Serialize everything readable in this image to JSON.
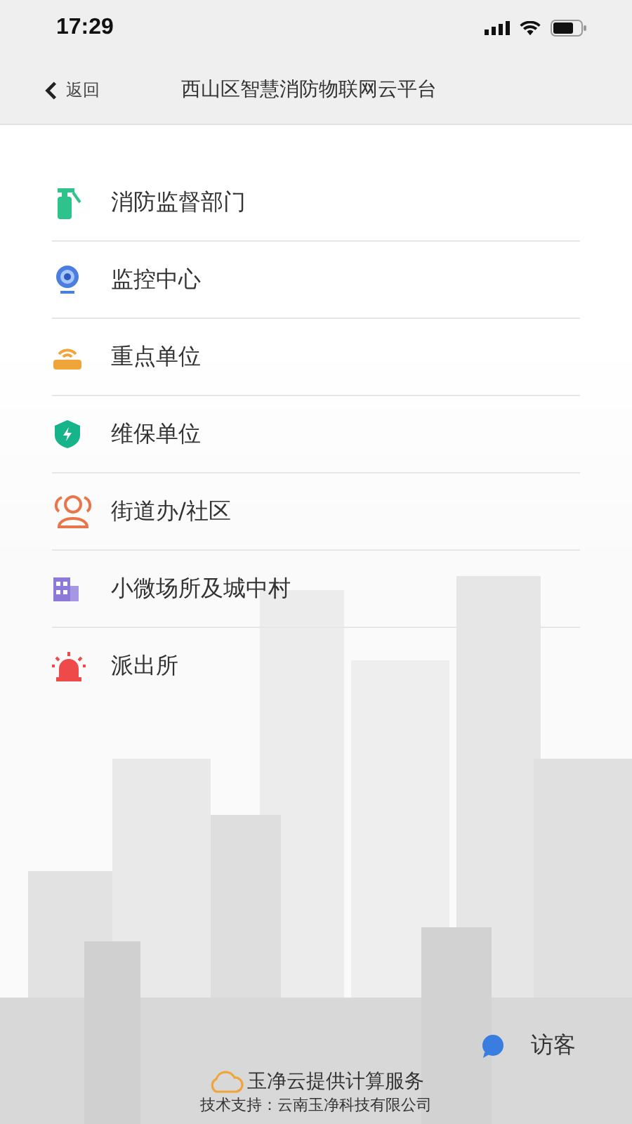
{
  "status_bar": {
    "time": "17:29"
  },
  "nav": {
    "back": "返回",
    "title": "西山区智慧消防物联网云平台"
  },
  "menu": [
    {
      "label": "消防监督部门",
      "kind": "extinguisher"
    },
    {
      "label": "监控中心",
      "kind": "camera"
    },
    {
      "label": "重点单位",
      "kind": "router"
    },
    {
      "label": "维保单位",
      "kind": "shield"
    },
    {
      "label": "街道办/社区",
      "kind": "people"
    },
    {
      "label": "小微场所及城中村",
      "kind": "building"
    },
    {
      "label": "派出所",
      "kind": "alarm"
    }
  ],
  "visitor": {
    "label": "访客"
  },
  "footer": {
    "service": "玉净云提供计算服务",
    "support": "技术支持：云南玉净科技有限公司"
  }
}
